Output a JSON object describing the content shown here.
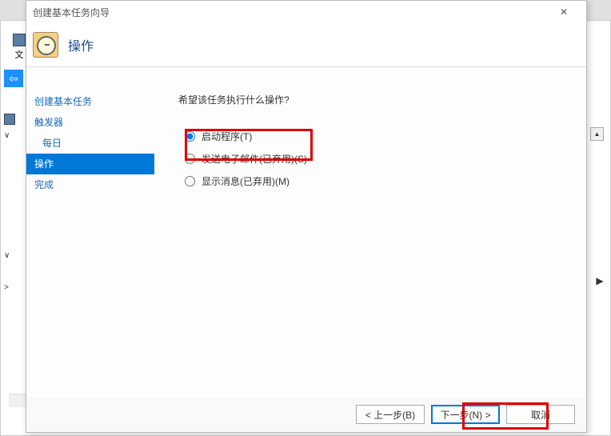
{
  "background": {
    "file_label": "文",
    "tree_root_label": "",
    "tree_caret1": "∨",
    "tree_caret2": "∨",
    "tree_caret3": ">"
  },
  "wizard": {
    "title": "创建基本任务向导",
    "header_title": "操作",
    "steps": {
      "create": "创建基本任务",
      "trigger": "触发器",
      "daily": "每日",
      "action": "操作",
      "finish": "完成"
    },
    "prompt": "希望该任务执行什么操作?",
    "options": {
      "start_program": "启动程序(T)",
      "send_email": "发送电子邮件(已弃用)(S)",
      "show_message": "显示消息(已弃用)(M)"
    },
    "selected_option": "start_program",
    "buttons": {
      "back": "< 上一步(B)",
      "next": "下一步(N) >",
      "cancel": "取消"
    }
  }
}
